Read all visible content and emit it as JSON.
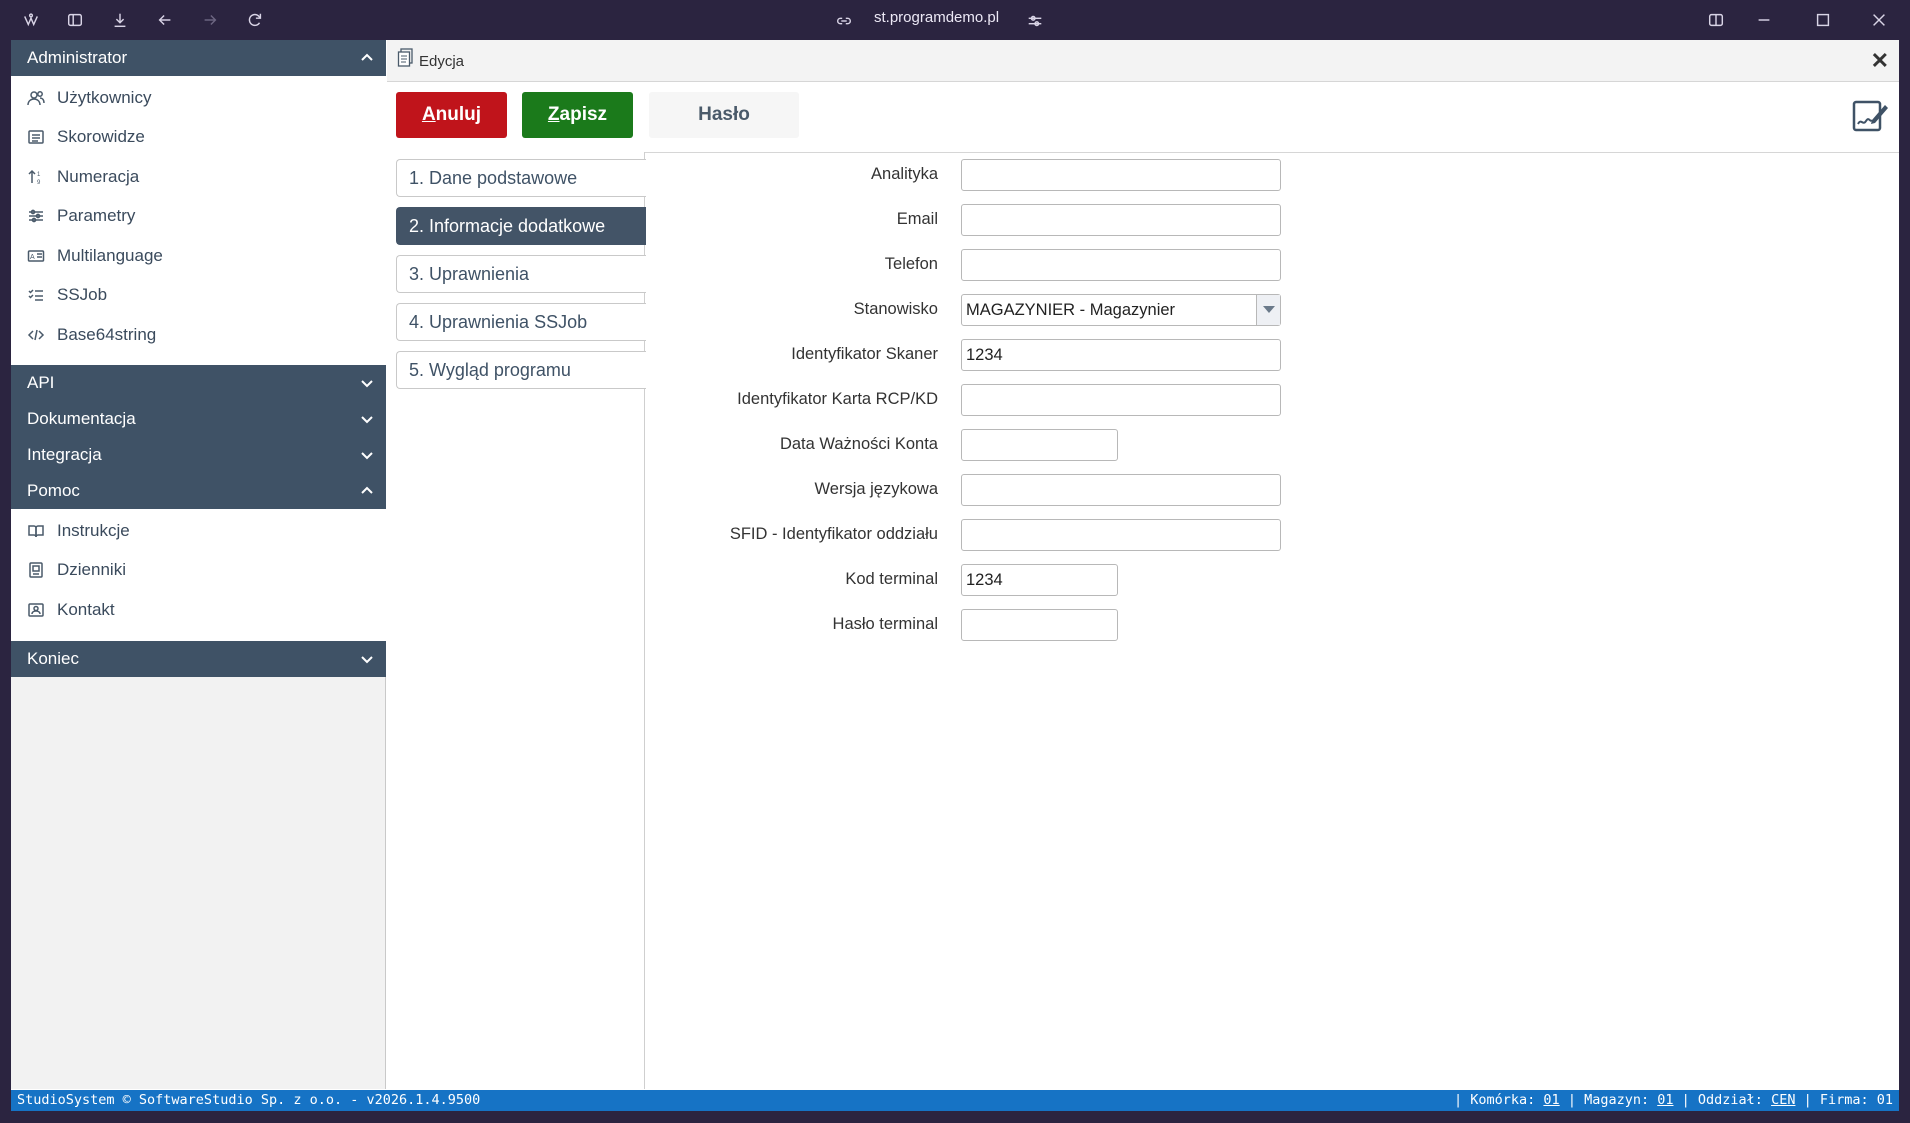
{
  "browser": {
    "url": "st.programdemo.pl"
  },
  "sidebar": {
    "sections": [
      {
        "title": "Administrator",
        "expanded": true,
        "items": [
          {
            "label": "Użytkownicy",
            "icon": "users-icon"
          },
          {
            "label": "Skorowidze",
            "icon": "list-icon"
          },
          {
            "label": "Numeracja",
            "icon": "sort-numeric-icon"
          },
          {
            "label": "Parametry",
            "icon": "sliders-icon"
          },
          {
            "label": "Multilanguage",
            "icon": "translate-icon"
          },
          {
            "label": "SSJob",
            "icon": "checklist-icon"
          },
          {
            "label": "Base64string",
            "icon": "code-icon"
          }
        ]
      },
      {
        "title": "API",
        "expanded": false
      },
      {
        "title": "Dokumentacja",
        "expanded": false
      },
      {
        "title": "Integracja",
        "expanded": false
      },
      {
        "title": "Pomoc",
        "expanded": true,
        "items": [
          {
            "label": "Instrukcje",
            "icon": "book-icon"
          },
          {
            "label": "Dzienniki",
            "icon": "journal-icon"
          },
          {
            "label": "Kontakt",
            "icon": "contact-icon"
          }
        ]
      },
      {
        "title": "Koniec",
        "expanded": false
      }
    ]
  },
  "editor": {
    "title": "Edycja",
    "buttons": {
      "cancel_first": "A",
      "cancel_rest": "nuluj",
      "save_first": "Z",
      "save_rest": "apisz",
      "password": "Hasło"
    },
    "tabs": [
      "1. Dane podstawowe",
      "2. Informacje dodatkowe",
      "3. Uprawnienia",
      "4. Uprawnienia SSJob",
      "5. Wygląd programu"
    ],
    "active_tab": 1,
    "fields": [
      {
        "label": "Analityka",
        "value": "",
        "width": "full"
      },
      {
        "label": "Email",
        "value": "",
        "width": "full"
      },
      {
        "label": "Telefon",
        "value": "",
        "width": "full"
      },
      {
        "label": "Stanowisko",
        "value": "MAGAZYNIER - Magazynier",
        "width": "full",
        "type": "select"
      },
      {
        "label": "Identyfikator Skaner",
        "value": "1234",
        "width": "full"
      },
      {
        "label": "Identyfikator Karta RCP/KD",
        "value": "",
        "width": "full"
      },
      {
        "label": "Data Ważności Konta",
        "value": "",
        "width": "short"
      },
      {
        "label": "Wersja językowa",
        "value": "",
        "width": "full"
      },
      {
        "label": "SFID - Identyfikator oddziału",
        "value": "",
        "width": "full"
      },
      {
        "label": "Kod terminal",
        "value": "1234",
        "width": "short"
      },
      {
        "label": "Hasło terminal",
        "value": "",
        "width": "short"
      }
    ]
  },
  "statusbar": {
    "left": "StudioSystem © SoftwareStudio Sp. z o.o. - v2026.1.4.9500",
    "komorka_label": "| Komórka:",
    "komorka": "01",
    "magazyn_label": "| Magazyn:",
    "magazyn": "01",
    "oddzial_label": "| Oddział:",
    "oddzial": "CEN",
    "firma_label": "| Firma: 01"
  },
  "colors": {
    "sidebar_header": "#3f5266",
    "cancel": "#c0141b",
    "save": "#1b7a1b",
    "statusbar": "#1673c5",
    "active_tab": "#435467"
  }
}
